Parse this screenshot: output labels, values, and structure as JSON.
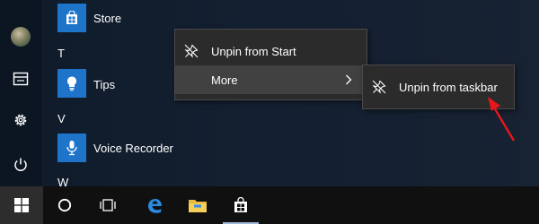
{
  "app_list": {
    "store_label": "Store",
    "group_t": "T",
    "tips_label": "Tips",
    "group_v": "V",
    "voice_recorder_label": "Voice Recorder",
    "group_w": "W"
  },
  "context_menu": {
    "unpin_start_label": "Unpin from Start",
    "more_label": "More"
  },
  "submenu": {
    "unpin_taskbar_label": "Unpin from taskbar"
  },
  "colors": {
    "tile_blue": "#1d74c8",
    "menu_bg": "#2b2b2b",
    "annotation_red": "#e8171b"
  },
  "icons": {
    "rail": [
      "avatar",
      "documents-icon",
      "settings-gear-icon",
      "power-icon"
    ],
    "taskbar": [
      "windows-logo-icon",
      "cortana-circle-icon",
      "task-view-icon",
      "edge-browser-icon",
      "file-explorer-icon",
      "store-bag-icon"
    ]
  }
}
